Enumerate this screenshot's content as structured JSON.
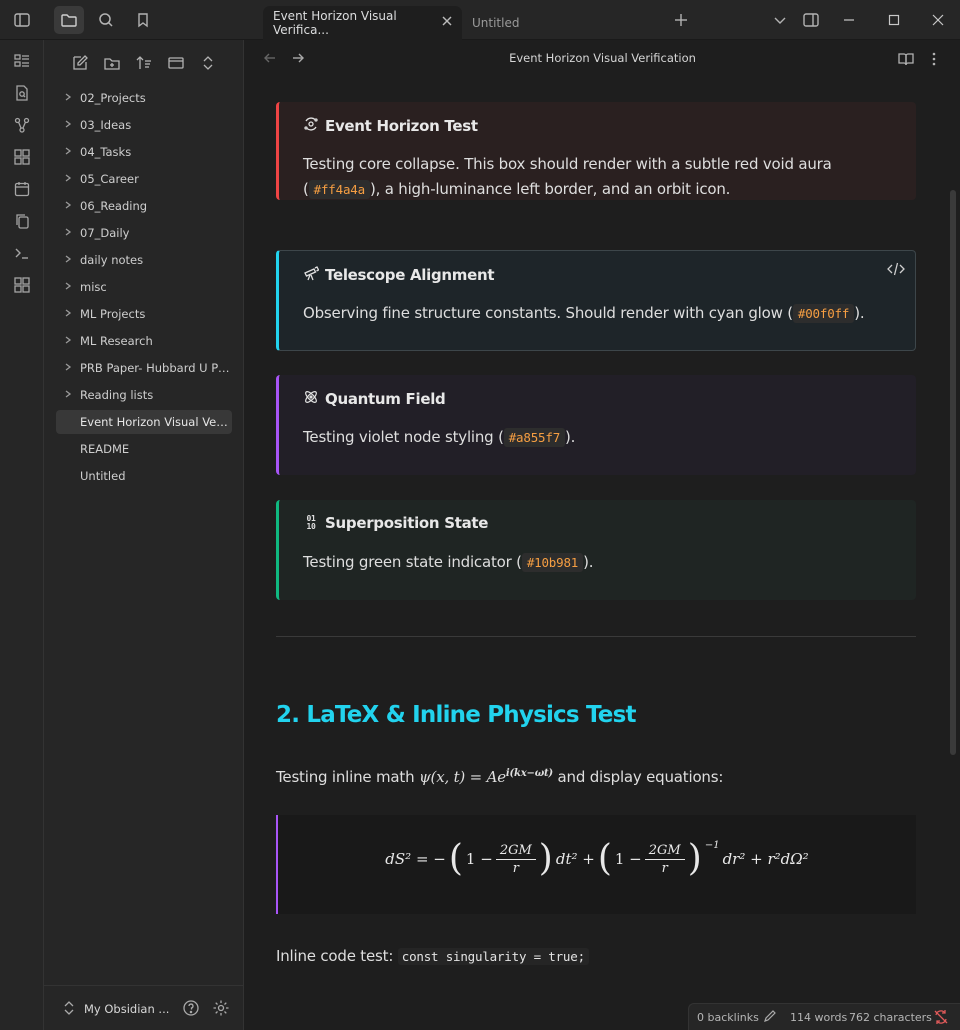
{
  "tabs": [
    {
      "label": "Event Horizon Visual Verifica..."
    },
    {
      "label": "Untitled"
    }
  ],
  "sidebar": {
    "items": [
      {
        "label": "02_Projects",
        "folder": true
      },
      {
        "label": "03_Ideas",
        "folder": true
      },
      {
        "label": "04_Tasks",
        "folder": true
      },
      {
        "label": "05_Career",
        "folder": true
      },
      {
        "label": "06_Reading",
        "folder": true
      },
      {
        "label": "07_Daily",
        "folder": true
      },
      {
        "label": "daily notes",
        "folder": true
      },
      {
        "label": "misc",
        "folder": true
      },
      {
        "label": "ML Projects",
        "folder": true
      },
      {
        "label": "ML Research",
        "folder": true
      },
      {
        "label": "PRB Paper- Hubbard U Pr...",
        "folder": true
      },
      {
        "label": "Reading lists",
        "folder": true
      },
      {
        "label": "Event Horizon Visual Veri...",
        "folder": false,
        "active": true
      },
      {
        "label": "README",
        "folder": false
      },
      {
        "label": "Untitled",
        "folder": false
      }
    ],
    "vault_name": "My Obsidian ..."
  },
  "note": {
    "title": "Event Horizon Visual Verification",
    "callouts": [
      {
        "title": "Event Horizon Test",
        "icon": "orbit-icon",
        "body_before": "Testing core collapse. This box should render with a subtle red void aura (",
        "code": "#ff4a4a",
        "body_after": "), a high-luminance left border, and an orbit icon.",
        "accent": "#ef4444",
        "bg": "#2a2020"
      },
      {
        "title": "Telescope Alignment",
        "icon": "telescope-icon",
        "body_before": "Observing fine structure constants. Should render with cyan glow (",
        "code": "#00f0ff",
        "body_after": ").",
        "accent": "#22d3ee",
        "bg": "#1e2529"
      },
      {
        "title": "Quantum Field",
        "icon": "atom-icon",
        "body_before": "Testing violet node styling (",
        "code": "#a855f7",
        "body_after": ").",
        "accent": "#a855f7",
        "bg": "#221f27"
      },
      {
        "title": "Superposition State",
        "icon": "binary-icon",
        "body_before": "Testing green state indicator (",
        "code": "#10b981",
        "body_after": ").",
        "accent": "#10b981",
        "bg": "#1f2523"
      }
    ],
    "heading": "2. LaTeX & Inline Physics Test",
    "inline_math_before": "Testing inline math ",
    "inline_math": "ψ(x, t) = Ae",
    "inline_math_exp": "i(kx−ωt)",
    "inline_math_after": " and display equations:",
    "equation": {
      "lhs": "dS² = −",
      "frac_num": "2GM",
      "frac_den": "r",
      "one": "1 −",
      "dt": "dt² +",
      "inv_exp": "−1",
      "tail": "dr² + r²dΩ²"
    },
    "inline_code_label": "Inline code test: ",
    "inline_code": "const singularity = true;"
  },
  "status": {
    "backlinks": "0 backlinks",
    "words": "114 words",
    "characters": "762 characters"
  }
}
